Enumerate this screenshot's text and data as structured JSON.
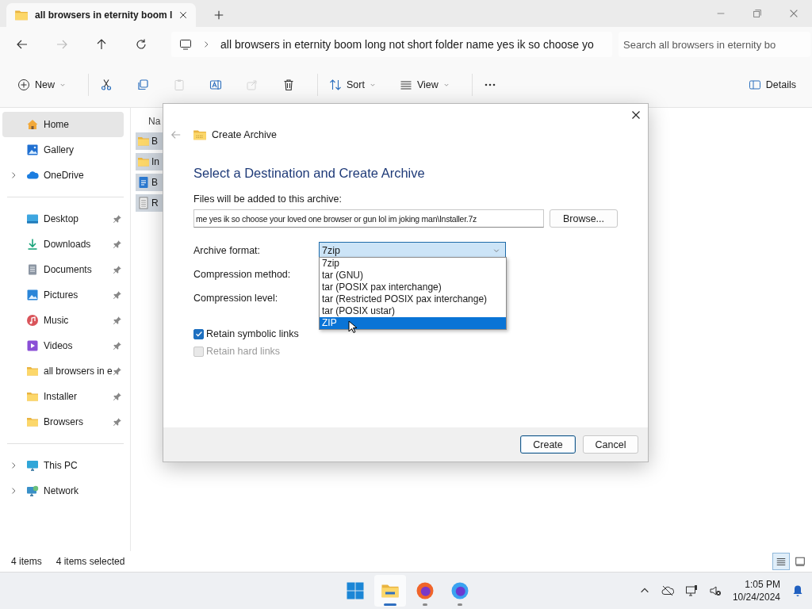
{
  "tab": {
    "title": "all browsers in eternity boom l"
  },
  "address": {
    "path": "all browsers in eternity boom long not short folder name yes ik so choose yo",
    "search_placeholder": "Search all browsers in eternity bo",
    "forward_disabled": true
  },
  "commands": [
    {
      "kind": "new",
      "label": "New",
      "disabled": false
    },
    {
      "kind": "cut",
      "disabled": false
    },
    {
      "kind": "copy",
      "disabled": false
    },
    {
      "kind": "paste",
      "disabled": true
    },
    {
      "kind": "rename",
      "disabled": false
    },
    {
      "kind": "share",
      "disabled": true
    },
    {
      "kind": "delete",
      "disabled": false
    },
    {
      "kind": "sort",
      "label": "Sort",
      "disabled": false
    },
    {
      "kind": "view",
      "label": "View",
      "disabled": false
    },
    {
      "kind": "more",
      "disabled": false
    }
  ],
  "details_button": {
    "label": "Details"
  },
  "sidebar": {
    "groups": [
      {
        "items": [
          {
            "kind": "home",
            "label": "Home",
            "selected": true,
            "pinned": false,
            "expandable": false
          },
          {
            "kind": "gallery",
            "label": "Gallery",
            "selected": false,
            "pinned": false,
            "expandable": false
          },
          {
            "kind": "cloud",
            "label": "OneDrive",
            "selected": false,
            "pinned": false,
            "expandable": true
          }
        ]
      },
      {
        "items": [
          {
            "kind": "desktop",
            "label": "Desktop",
            "selected": false,
            "pinned": true,
            "expandable": false
          },
          {
            "kind": "downloads",
            "label": "Downloads",
            "selected": false,
            "pinned": true,
            "expandable": false
          },
          {
            "kind": "documents",
            "label": "Documents",
            "selected": false,
            "pinned": true,
            "expandable": false
          },
          {
            "kind": "pictures",
            "label": "Pictures",
            "selected": false,
            "pinned": true,
            "expandable": false
          },
          {
            "kind": "music",
            "label": "Music",
            "selected": false,
            "pinned": true,
            "expandable": false
          },
          {
            "kind": "videos",
            "label": "Videos",
            "selected": false,
            "pinned": true,
            "expandable": false
          },
          {
            "kind": "folder",
            "label": "all browsers in e",
            "selected": false,
            "pinned": true,
            "expandable": false
          },
          {
            "kind": "folder",
            "label": "Installer",
            "selected": false,
            "pinned": true,
            "expandable": false
          },
          {
            "kind": "folder",
            "label": "Browsers",
            "selected": false,
            "pinned": true,
            "expandable": false
          }
        ]
      },
      {
        "items": [
          {
            "kind": "pc",
            "label": "This PC",
            "selected": false,
            "pinned": false,
            "expandable": true
          },
          {
            "kind": "network",
            "label": "Network",
            "selected": false,
            "pinned": false,
            "expandable": true
          }
        ]
      }
    ]
  },
  "file_list": {
    "column_1": "Na",
    "rows": [
      {
        "kind": "folder",
        "name": "B",
        "selected": true
      },
      {
        "kind": "folder",
        "name": "In",
        "selected": true
      },
      {
        "kind": "document",
        "name": "B",
        "selected": true
      },
      {
        "kind": "text",
        "name": "R",
        "selected": true
      }
    ]
  },
  "dialog": {
    "title": "Create Archive",
    "heading": "Select a Destination and Create Archive",
    "files_label": "Files will be added to this archive:",
    "path": "me yes ik so choose your loved one browser or gun lol im joking man\\Installer.7z",
    "browse_button": "Browse...",
    "archive_format": {
      "label": "Archive format:",
      "value": "7zip",
      "expanded": true,
      "options": [
        {
          "label": "7zip",
          "highlighted": false
        },
        {
          "label": "tar (GNU)",
          "highlighted": false
        },
        {
          "label": "tar (POSIX pax interchange)",
          "highlighted": false
        },
        {
          "label": "tar (Restricted POSIX pax interchange)",
          "highlighted": false
        },
        {
          "label": "tar (POSIX ustar)",
          "highlighted": false
        },
        {
          "label": "ZIP",
          "highlighted": true
        }
      ]
    },
    "compression_method_label": "Compression method:",
    "compression_level_label": "Compression level:",
    "checkboxes": [
      {
        "label": "Retain symbolic links",
        "checked": true,
        "disabled": false
      },
      {
        "label": "Retain hard links",
        "checked": false,
        "disabled": true
      }
    ],
    "buttons": [
      {
        "label": "Create",
        "default": true
      },
      {
        "label": "Cancel",
        "default": false
      }
    ]
  },
  "status_bar": {
    "item_count": "4 items",
    "selection": "4 items selected",
    "views": [
      {
        "kind": "details",
        "selected": true
      },
      {
        "kind": "tiles",
        "selected": false
      }
    ]
  },
  "taskbar": {
    "apps": [
      {
        "kind": "start",
        "active": false,
        "running": false
      },
      {
        "kind": "explorer",
        "active": true,
        "running": true
      },
      {
        "kind": "firefox",
        "active": false,
        "running": true
      },
      {
        "kind": "firefox-dev",
        "active": false,
        "running": true
      }
    ],
    "time": "1:05 PM",
    "date": "10/24/2024"
  }
}
